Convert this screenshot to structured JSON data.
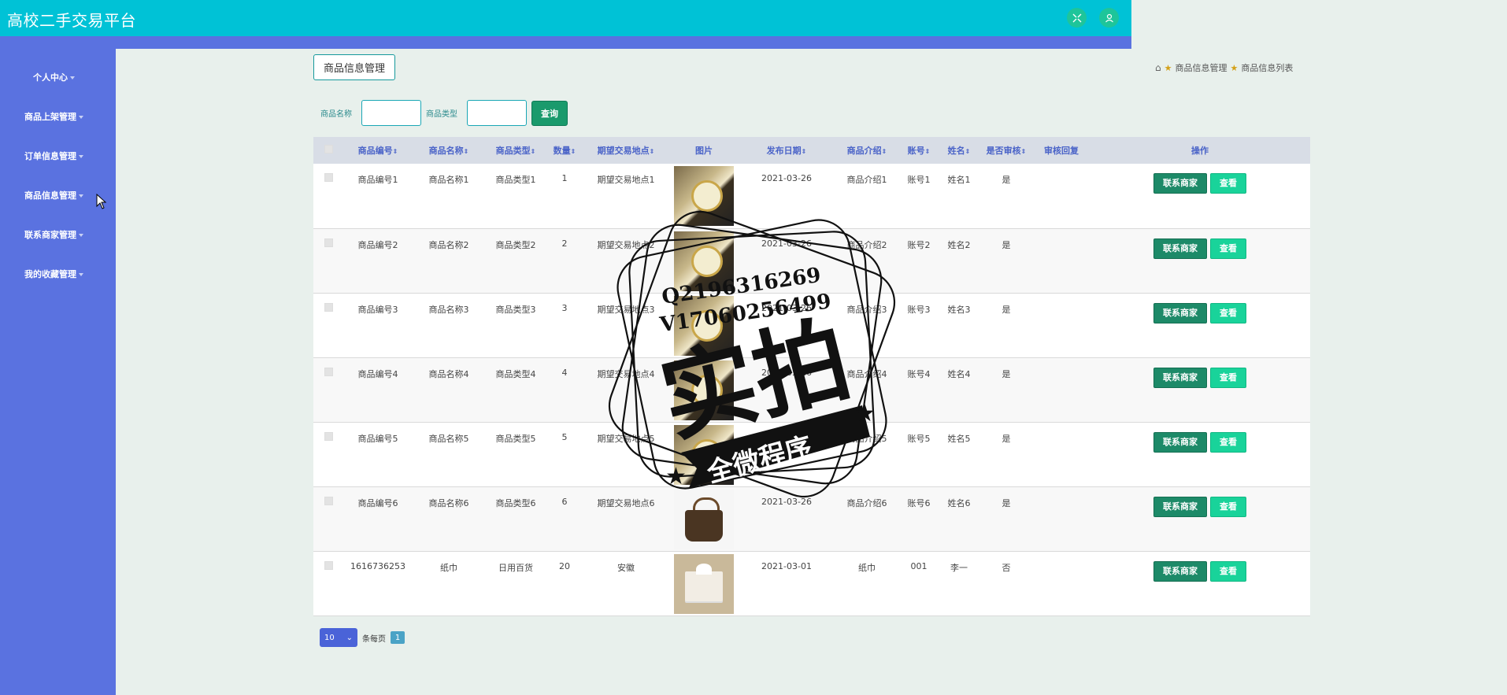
{
  "app": {
    "title": "高校二手交易平台"
  },
  "sidebar": {
    "items": [
      {
        "label": "个人中心"
      },
      {
        "label": "商品上架管理"
      },
      {
        "label": "订单信息管理"
      },
      {
        "label": "商品信息管理"
      },
      {
        "label": "联系商家管理"
      },
      {
        "label": "我的收藏管理"
      }
    ]
  },
  "page": {
    "tag": "商品信息管理",
    "breadcrumb": [
      "商品信息管理",
      "商品信息列表"
    ]
  },
  "search": {
    "name_label": "商品名称",
    "type_label": "商品类型",
    "name_value": "",
    "type_value": "",
    "query_label": "查询"
  },
  "table": {
    "headers": [
      "商品编号",
      "商品名称",
      "商品类型",
      "数量",
      "期望交易地点",
      "图片",
      "发布日期",
      "商品介绍",
      "账号",
      "姓名",
      "是否审核",
      "审核回复",
      "操作"
    ],
    "contact_label": "联系商家",
    "view_label": "查看",
    "rows": [
      {
        "code": "商品编号1",
        "name": "商品名称1",
        "type": "商品类型1",
        "qty": "1",
        "place": "期望交易地点1",
        "image": "watch",
        "date": "2021-03-26",
        "intro": "商品介绍1",
        "account": "账号1",
        "person": "姓名1",
        "audit": "是",
        "reply": ""
      },
      {
        "code": "商品编号2",
        "name": "商品名称2",
        "type": "商品类型2",
        "qty": "2",
        "place": "期望交易地点2",
        "image": "watch",
        "date": "2021-03-26",
        "intro": "商品介绍2",
        "account": "账号2",
        "person": "姓名2",
        "audit": "是",
        "reply": ""
      },
      {
        "code": "商品编号3",
        "name": "商品名称3",
        "type": "商品类型3",
        "qty": "3",
        "place": "期望交易地点3",
        "image": "watch",
        "date": "2021-03-26",
        "intro": "商品介绍3",
        "account": "账号3",
        "person": "姓名3",
        "audit": "是",
        "reply": ""
      },
      {
        "code": "商品编号4",
        "name": "商品名称4",
        "type": "商品类型4",
        "qty": "4",
        "place": "期望交易地点4",
        "image": "watch",
        "date": "2021-03-26",
        "intro": "商品介绍4",
        "account": "账号4",
        "person": "姓名4",
        "audit": "是",
        "reply": ""
      },
      {
        "code": "商品编号5",
        "name": "商品名称5",
        "type": "商品类型5",
        "qty": "5",
        "place": "期望交易地点5",
        "image": "watch",
        "date": "2021-03-26",
        "intro": "商品介绍5",
        "account": "账号5",
        "person": "姓名5",
        "audit": "是",
        "reply": ""
      },
      {
        "code": "商品编号6",
        "name": "商品名称6",
        "type": "商品类型6",
        "qty": "6",
        "place": "期望交易地点6",
        "image": "bag",
        "date": "2021-03-26",
        "intro": "商品介绍6",
        "account": "账号6",
        "person": "姓名6",
        "audit": "是",
        "reply": ""
      },
      {
        "code": "1616736253",
        "name": "纸巾",
        "type": "日用百货",
        "qty": "20",
        "place": "安徽",
        "image": "tissue",
        "date": "2021-03-01",
        "intro": "纸巾",
        "account": "001",
        "person": "李一",
        "audit": "否",
        "reply": ""
      }
    ]
  },
  "pager": {
    "page_size": "10",
    "per_page_label": "条每页",
    "current_page": "1"
  },
  "watermark": {
    "contact_q": "Q2196316269",
    "contact_v": "V17060256499",
    "main_text": "实拍",
    "banner_text": "全微程序"
  },
  "colors": {
    "topbar": "#00c2d6",
    "sidebar": "#5a72e0",
    "accent_green": "#1d8a68",
    "view_green": "#19d39a"
  }
}
